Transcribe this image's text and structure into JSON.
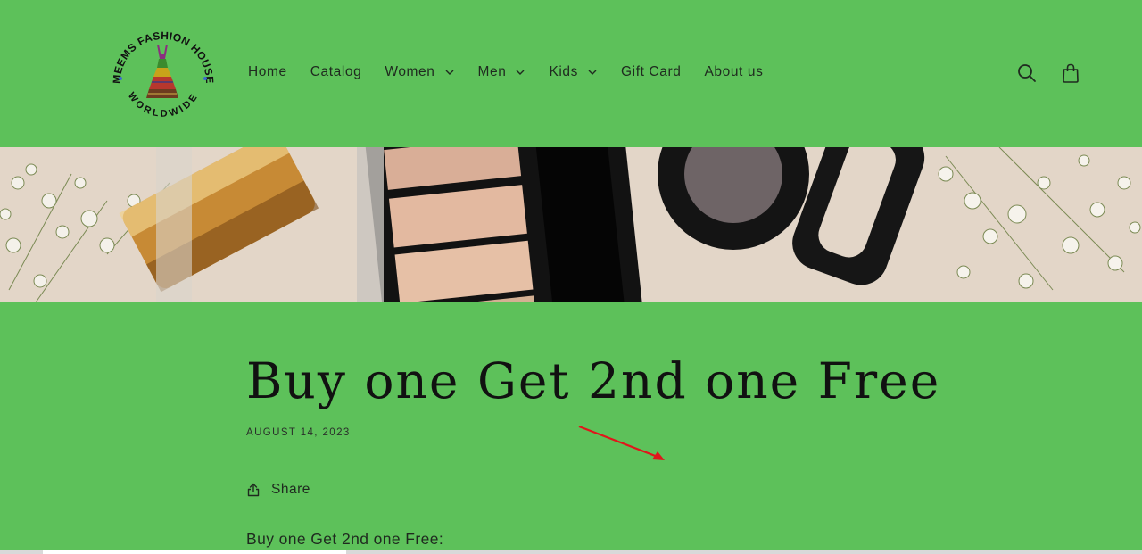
{
  "header": {
    "logo": {
      "top_text": "MEEMS FASHION HOUSE",
      "bottom_text": "WORLDWIDE"
    },
    "nav": [
      {
        "label": "Home",
        "has_dropdown": false
      },
      {
        "label": "Catalog",
        "has_dropdown": false
      },
      {
        "label": "Women",
        "has_dropdown": true
      },
      {
        "label": "Men",
        "has_dropdown": true
      },
      {
        "label": "Kids",
        "has_dropdown": true
      },
      {
        "label": "Gift Card",
        "has_dropdown": false
      },
      {
        "label": "About us",
        "has_dropdown": false
      }
    ],
    "icons": {
      "search": "search-icon",
      "cart": "cart-icon"
    }
  },
  "article": {
    "title": "Buy one Get 2nd one Free",
    "date": "AUGUST 14, 2023",
    "share_label": "Share",
    "body_intro": "Buy one Get 2nd one Free:"
  },
  "colors": {
    "page_background": "#5dc15a",
    "text": "#1a1a1a",
    "annotation_arrow": "#e0161b"
  }
}
